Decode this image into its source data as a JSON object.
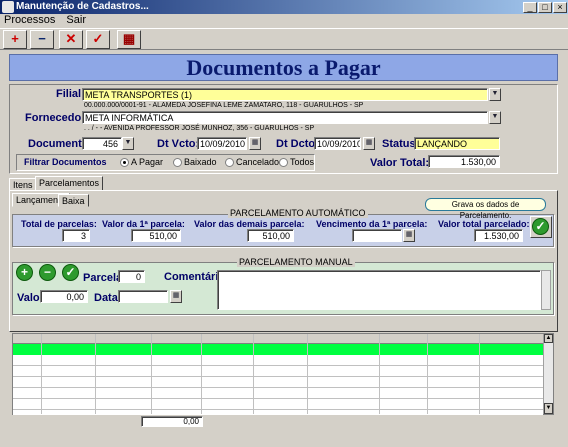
{
  "window": {
    "title": "Manutenção de Cadastros..."
  },
  "menu": [
    "Processos",
    "Sair"
  ],
  "toolbar": {
    "buttons": [
      "add-icon",
      "remove-icon",
      "cancel-icon",
      "confirm-icon",
      "calculator-icon"
    ]
  },
  "banner": {
    "title": "Documentos a Pagar"
  },
  "header": {
    "filial_label": "Filial",
    "filial_value": "META TRANSPORTES (1)",
    "filial_address": "00.000.000/0001-91 - ALAMEDA JOSEFINA LEME ZAMATARO, 118 - GUARULHOS - SP",
    "fornecedor_label": "Fornecedor",
    "fornecedor_value": "META INFORMÁTICA",
    "fornecedor_address": ". . / - - AVENIDA PROFESSOR JOSÉ MUNHOZ, 356 - GUARULHOS - SP",
    "documento_label": "Documento",
    "documento_value": "456",
    "dtvcto_label": "Dt Vcto:",
    "dtvcto_value": "10/09/2010",
    "dtdcto_label": "Dt Dcto:",
    "dtdcto_value": "10/09/2010",
    "status_label": "Status:",
    "status_value": "LANÇANDO",
    "filtrar_label": "Filtrar Documentos",
    "filtros": [
      "A Pagar",
      "Baixado",
      "Cancelados",
      "Todos"
    ],
    "filtro_selected": "A Pagar",
    "valor_total_label": "Valor Total:",
    "valor_total_value": "1.530,00"
  },
  "tabs": [
    "Itens",
    "Parcelamentos"
  ],
  "subtabs": [
    "Lançamento",
    "Baixa"
  ],
  "auto": {
    "group_title": "PARCELAMENTO AUTOMÁTICO",
    "total_label": "Total de parcelas:",
    "total_value": "3",
    "primeira_label": "Valor da 1ª parcela:",
    "primeira_value": "510,00",
    "demais_label": "Valor das demais parcela:",
    "demais_value": "510,00",
    "vencimento_label": "Vencimento da 1ª parcela:",
    "vencimento_value": "",
    "valor_total_label": "Valor total parcelado:",
    "valor_total_value": "1.530,00",
    "tooltip": "Grava os dados de Parcelamento."
  },
  "manual": {
    "group_title": "PARCELAMENTO MANUAL",
    "parcela_label": "Parcela:",
    "parcela_value": "0",
    "comentarios_label": "Comentários:",
    "valor_label": "Valor:",
    "valor_value": "0,00",
    "data_label": "Data:"
  },
  "grid": {
    "footer_total": "0,00"
  },
  "colors": {
    "banner": "#8ea7e6",
    "highlight_row": "#00ff40",
    "yellow_field": "#ffff99",
    "confirm_green": "#2e9a2e"
  }
}
